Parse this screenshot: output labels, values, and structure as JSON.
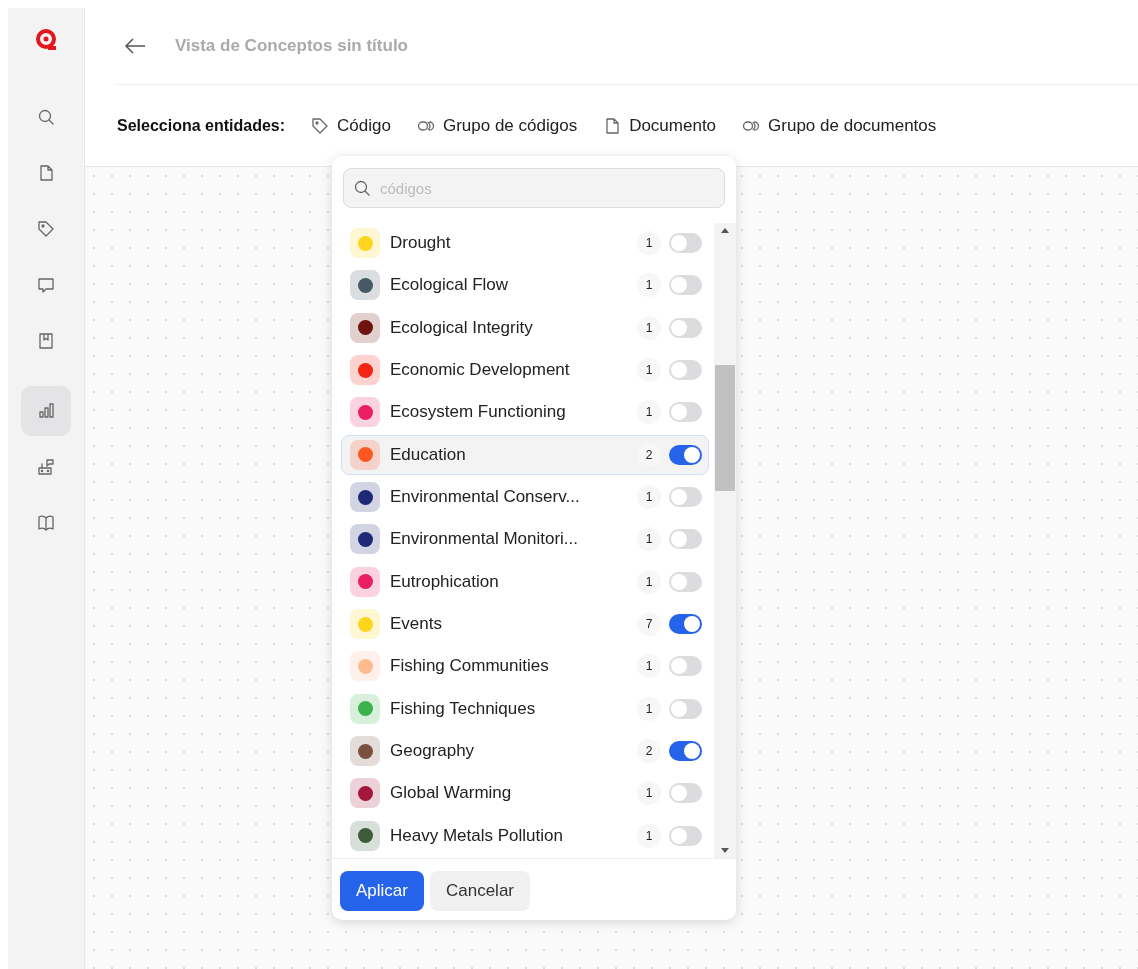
{
  "sidebar": {
    "items": [
      {
        "kind": "search",
        "selected": false
      },
      {
        "kind": "document",
        "selected": false
      },
      {
        "kind": "tag",
        "selected": false
      },
      {
        "kind": "comment",
        "selected": false
      },
      {
        "kind": "bookmark",
        "selected": false
      },
      {
        "kind": "chart",
        "selected": true
      },
      {
        "kind": "diagram",
        "selected": false
      },
      {
        "kind": "book",
        "selected": false
      }
    ]
  },
  "header": {
    "title": "Vista de Conceptos sin título"
  },
  "entity_bar": {
    "label": "Selecciona entidades:",
    "options": [
      {
        "kind": "tag",
        "label": "Código"
      },
      {
        "kind": "group",
        "label": "Grupo de códigos"
      },
      {
        "kind": "document",
        "label": "Documento"
      },
      {
        "kind": "group",
        "label": "Grupo de documentos"
      }
    ]
  },
  "popup": {
    "search": {
      "placeholder": "códigos"
    },
    "codes": [
      {
        "name": "Drought",
        "color": "#fdd51c",
        "count": "1",
        "on": false,
        "selected": false
      },
      {
        "name": "Ecological Flow",
        "color": "#455a64",
        "count": "1",
        "on": false,
        "selected": false
      },
      {
        "name": "Ecological Integrity",
        "color": "#6d1410",
        "count": "1",
        "on": false,
        "selected": false
      },
      {
        "name": "Economic Development",
        "color": "#f42414",
        "count": "1",
        "on": false,
        "selected": false
      },
      {
        "name": "Ecosystem Functioning",
        "color": "#e91e63",
        "count": "1",
        "on": false,
        "selected": false
      },
      {
        "name": "Education",
        "color": "#ff5722",
        "count": "2",
        "on": true,
        "selected": true
      },
      {
        "name": "Environmental Conserv...",
        "color": "#1e2a78",
        "count": "1",
        "on": false,
        "selected": false
      },
      {
        "name": "Environmental Monitori...",
        "color": "#1e2a78",
        "count": "1",
        "on": false,
        "selected": false
      },
      {
        "name": "Eutrophication",
        "color": "#e91e63",
        "count": "1",
        "on": false,
        "selected": false
      },
      {
        "name": "Events",
        "color": "#fdd51c",
        "count": "7",
        "on": true,
        "selected": false
      },
      {
        "name": "Fishing Communities",
        "color": "#ffbb90",
        "count": "1",
        "on": false,
        "selected": false
      },
      {
        "name": "Fishing Techniques",
        "color": "#3bb24a",
        "count": "1",
        "on": false,
        "selected": false
      },
      {
        "name": "Geography",
        "color": "#7a5040",
        "count": "2",
        "on": true,
        "selected": false
      },
      {
        "name": "Global Warming",
        "color": "#a3173f",
        "count": "1",
        "on": false,
        "selected": false
      },
      {
        "name": "Heavy Metals Pollution",
        "color": "#3d5a3a",
        "count": "1",
        "on": false,
        "selected": false
      }
    ],
    "buttons": [
      {
        "kind": "primary",
        "label": "Aplicar"
      },
      {
        "kind": "secondary",
        "label": "Cancelar"
      }
    ]
  }
}
